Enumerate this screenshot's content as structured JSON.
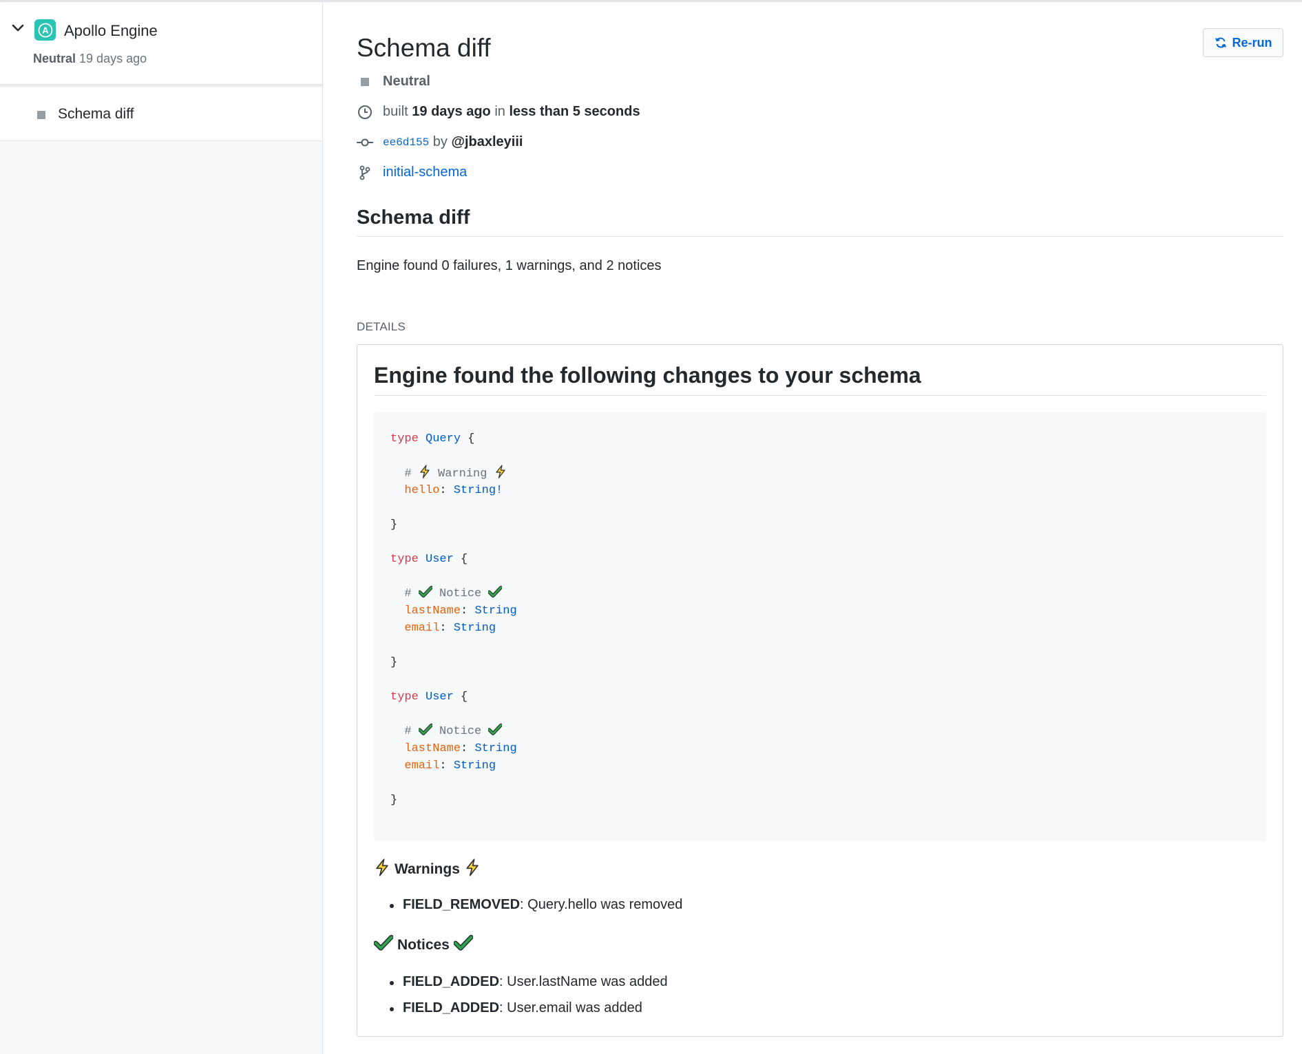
{
  "sidebar": {
    "app_name": "Apollo Engine",
    "app_logo_letter": "A",
    "status_label": "Neutral",
    "status_time": "19 days ago",
    "check_run_label": "Schema diff"
  },
  "header": {
    "title": "Schema diff",
    "rerun_label": "Re-run",
    "status": "Neutral",
    "built_prefix": "built",
    "built_time": "19 days ago",
    "built_in": "in",
    "built_duration": "less than 5 seconds",
    "commit_sha": "ee6d155",
    "commit_by": "by",
    "commit_author": "@jbaxleyiii",
    "branch": "initial-schema"
  },
  "summary": {
    "heading": "Schema diff",
    "text": "Engine found 0 failures, 1 warnings, and 2 notices"
  },
  "details": {
    "label": "DETAILS",
    "heading": "Engine found the following changes to your schema",
    "code_blocks": [
      {
        "keyword": "type",
        "type_name": "Query",
        "comment_label": "Warning",
        "comment_icon": "lightning-icon",
        "fields": [
          {
            "name": "hello",
            "type": "String!"
          }
        ]
      },
      {
        "keyword": "type",
        "type_name": "User",
        "comment_label": "Notice",
        "comment_icon": "check-icon",
        "fields": [
          {
            "name": "lastName",
            "type": "String"
          },
          {
            "name": "email",
            "type": "String"
          }
        ]
      },
      {
        "keyword": "type",
        "type_name": "User",
        "comment_label": "Notice",
        "comment_icon": "check-icon",
        "fields": [
          {
            "name": "lastName",
            "type": "String"
          },
          {
            "name": "email",
            "type": "String"
          }
        ]
      }
    ],
    "warnings_title": "Warnings",
    "warnings": [
      {
        "code": "FIELD_REMOVED",
        "message": ": Query.hello was removed"
      }
    ],
    "notices_title": "Notices",
    "notices": [
      {
        "code": "FIELD_ADDED",
        "message": ": User.lastName was added"
      },
      {
        "code": "FIELD_ADDED",
        "message": ": User.email was added"
      }
    ]
  },
  "colors": {
    "link": "#0366d6",
    "app_logo": "#2bc3b4",
    "keyword": "#d73a49",
    "type_name": "#005cc5",
    "field_name": "#e36209"
  }
}
